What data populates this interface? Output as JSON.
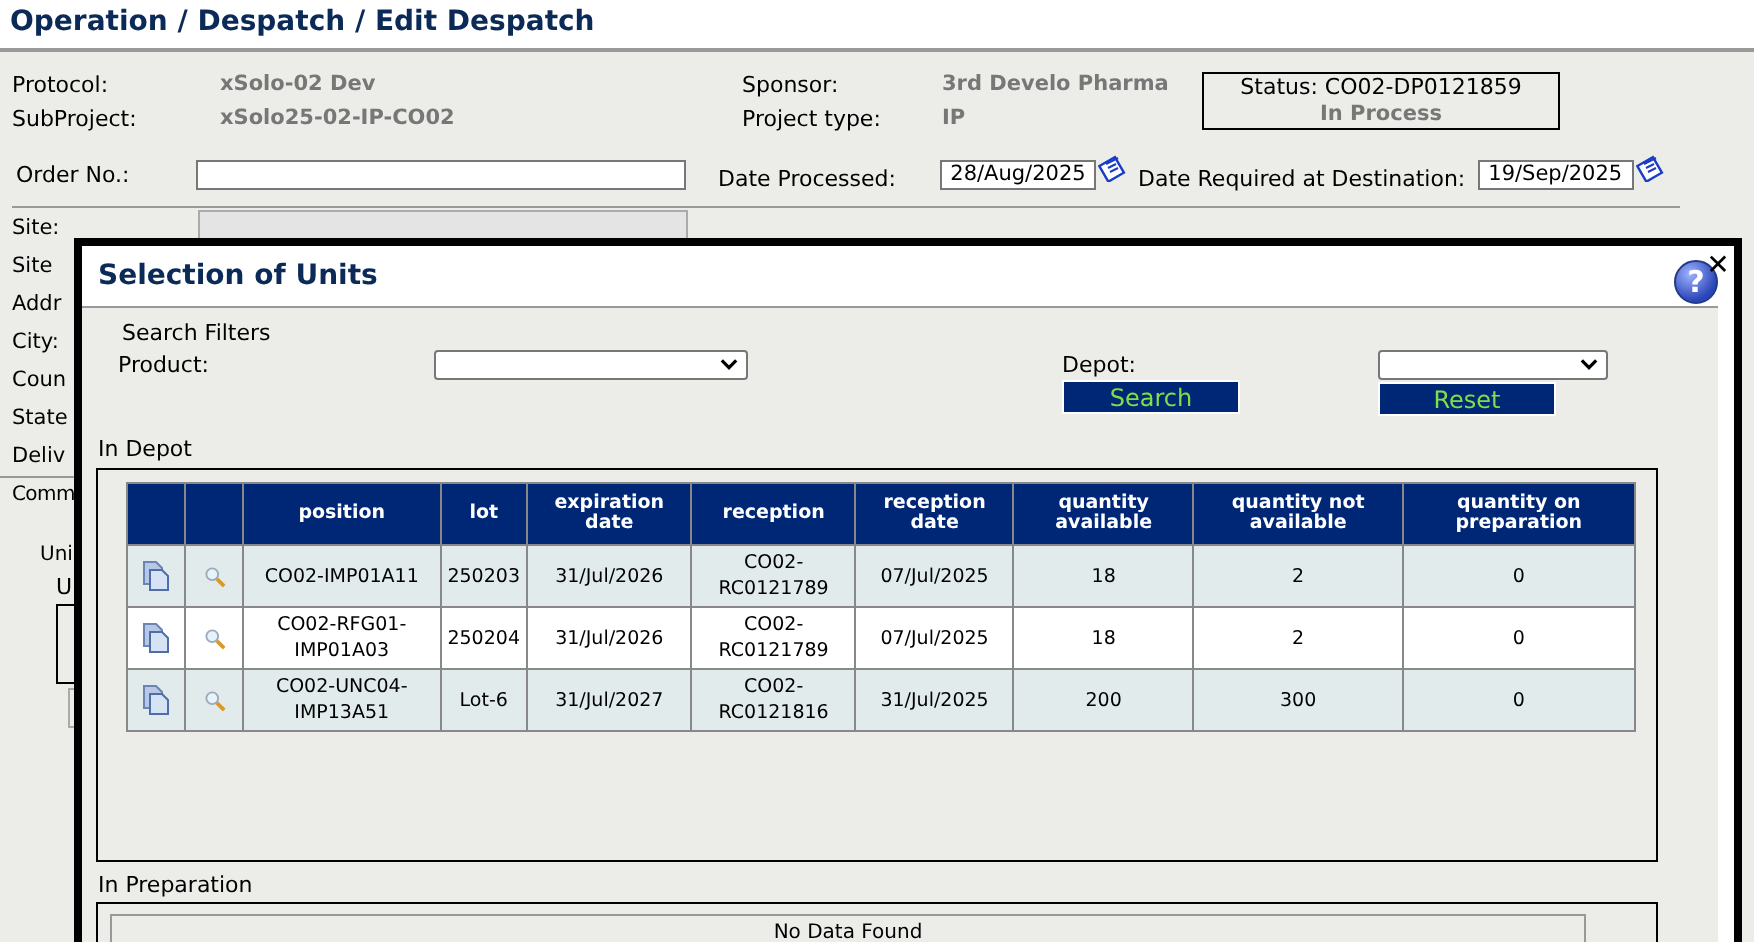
{
  "page_title": "Operation / Despatch / Edit Despatch",
  "info": [
    {
      "label": "Protocol:",
      "value": "xSolo-02 Dev",
      "label2": "Sponsor:",
      "value2": "3rd Develo Pharma"
    },
    {
      "label": "SubProject:",
      "value": "xSolo25-02-IP-CO02",
      "label2": "Project type:",
      "value2": "IP"
    }
  ],
  "status": {
    "label": "Status: CO02-DP0121859",
    "state": "In Process"
  },
  "order_no": {
    "label": "Order No.:"
  },
  "dates": [
    {
      "label": "Date Processed:",
      "value": "28/Aug/2025"
    },
    {
      "label": "Date Required at Destination:",
      "value": "19/Sep/2025"
    }
  ],
  "site_labels": [
    "Site:",
    "Site",
    "Addr",
    "City:",
    "Coun",
    "State",
    "Deliv"
  ],
  "comments_label": "Comm",
  "units_labels": [
    "Uni",
    "U"
  ],
  "dialog": {
    "title": "Selection of Units",
    "help": "?",
    "close": "✕",
    "filters_title": "Search Filters",
    "product": {
      "label": "Product:"
    },
    "depot": {
      "label": "Depot:"
    },
    "buttons": [
      "Search",
      "Reset"
    ],
    "in_depot": {
      "title": "In Depot",
      "columns": [
        "",
        "",
        "position",
        "lot",
        "expiration date",
        "reception",
        "reception date",
        "quantity available",
        "quantity not available",
        "quantity on preparation"
      ],
      "rows": [
        {
          "cells": [
            "",
            "",
            "CO02-IMP01A11",
            "250203",
            "31/Jul/2026",
            "CO02-RC0121789",
            "07/Jul/2025",
            "18",
            "2",
            "0"
          ]
        },
        {
          "cells": [
            "",
            "",
            "CO02-RFG01-IMP01A03",
            "250204",
            "31/Jul/2026",
            "CO02-RC0121789",
            "07/Jul/2025",
            "18",
            "2",
            "0"
          ]
        },
        {
          "cells": [
            "",
            "",
            "CO02-UNC04-IMP13A51",
            "Lot-6",
            "31/Jul/2027",
            "CO02-RC0121816",
            "31/Jul/2025",
            "200",
            "300",
            "0"
          ]
        }
      ]
    },
    "in_preparation": {
      "title": "In Preparation",
      "empty_text": "No Data Found"
    }
  }
}
